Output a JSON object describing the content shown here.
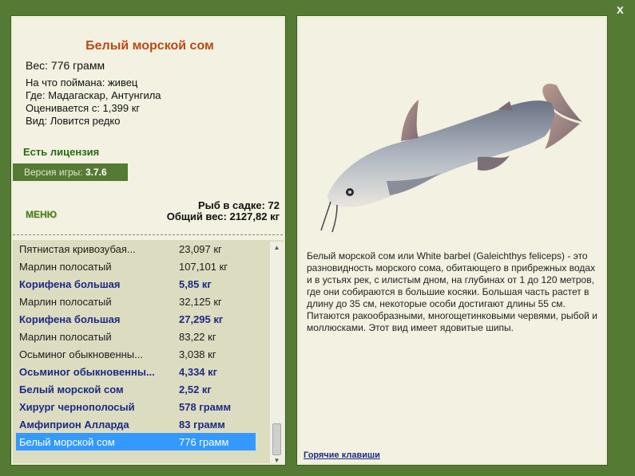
{
  "close_label": "x",
  "fish": {
    "title": "Белый морской сом",
    "weight": "Вес: 776 грамм",
    "caught_by": "На что поймана: живец",
    "where": "Где: Мадагаскар, Антунгила",
    "valued": "Оценивается с: 1,399 кг",
    "kind": "Вид: Ловится редко",
    "description": "Белый морской сом или White barbel (Galeichthys feliceps) - это разновидность морского сома, обитающего в прибрежных водах и в устьях рек, с илистым дном, на глубинах от 1 до 120 метров, где они собираются в большие косяки. Большая часть растет в длину до 35 см, некоторые особи достигают длины 55 см. Питаются ракообразными, многощетинковыми червями, рыбой и моллюсками. Этот вид имеет ядовитые шипы."
  },
  "license": "Есть лицензия",
  "version": {
    "label": "Версия игры: ",
    "value": "3.7.6"
  },
  "menu_label": "МЕНЮ",
  "keepnet": {
    "count": "Рыб в садке: 72",
    "total": "Общий вес: 2127,82 кг"
  },
  "fish_list": [
    {
      "name": "Пятнистая кривозубая...",
      "weight": "23,097 кг",
      "style": "normal"
    },
    {
      "name": "Марлин полосатый",
      "weight": "107,101 кг",
      "style": "normal"
    },
    {
      "name": "Корифена большая",
      "weight": "5,85 кг",
      "style": "bold"
    },
    {
      "name": "Марлин полосатый",
      "weight": "32,125 кг",
      "style": "normal"
    },
    {
      "name": "Корифена большая",
      "weight": "27,295 кг",
      "style": "bold"
    },
    {
      "name": "Марлин полосатый",
      "weight": "83,22 кг",
      "style": "normal"
    },
    {
      "name": "Осьминог обыкновенны...",
      "weight": "3,038 кг",
      "style": "normal"
    },
    {
      "name": "Осьминог обыкновенны...",
      "weight": "4,334 кг",
      "style": "bold"
    },
    {
      "name": "Белый морской сом",
      "weight": "2,52 кг",
      "style": "bold"
    },
    {
      "name": "Хирург чернополосый",
      "weight": "578 грамм",
      "style": "bold"
    },
    {
      "name": "Амфиприон Алларда",
      "weight": "83 грамм",
      "style": "bold"
    },
    {
      "name": "Белый морской сом",
      "weight": "776 грамм",
      "style": "selected"
    }
  ],
  "hotkeys_label": "Горячие клавиши",
  "colors": {
    "background": "#557a34",
    "panel": "#f3f1e1",
    "title": "#b84a14",
    "license": "#2a6a12",
    "bold_row": "#1d2a83",
    "selection": "#3399ff"
  },
  "icons": {
    "close": "close-icon",
    "scroll_up": "triangle-up-icon",
    "scroll_down": "triangle-down-icon"
  }
}
